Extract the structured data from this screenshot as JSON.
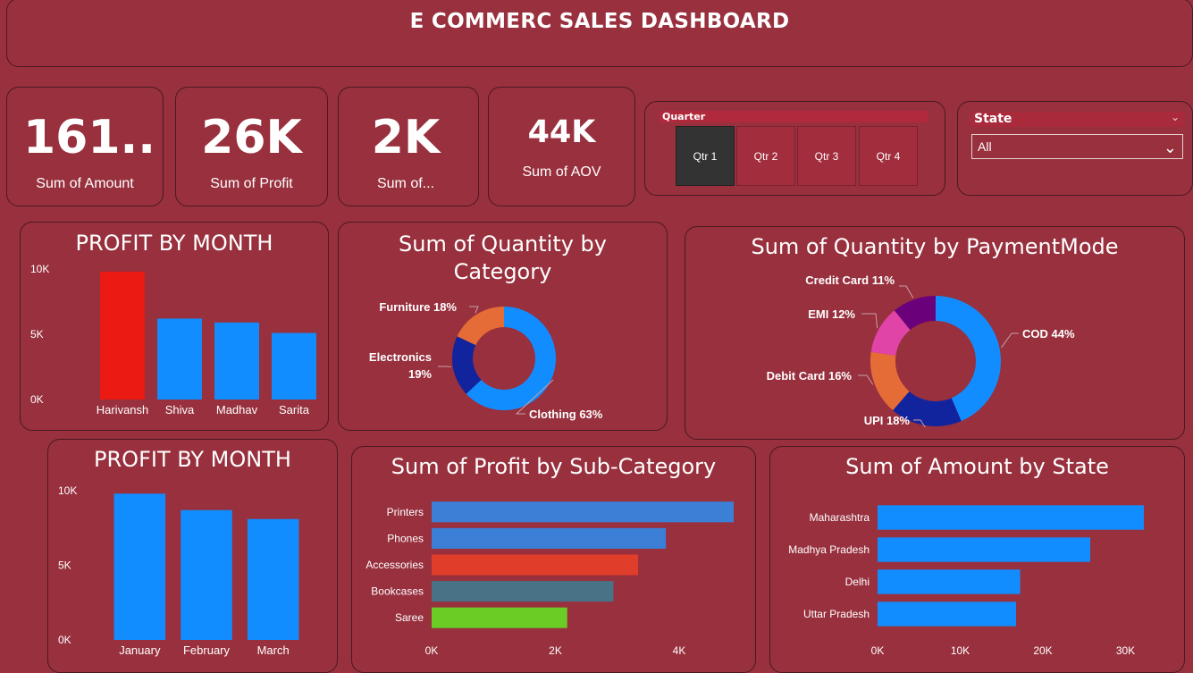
{
  "header": {
    "title": "E COMMERC SALES DASHBOARD"
  },
  "kpis": [
    {
      "value": "161..",
      "label": "Sum of Amount"
    },
    {
      "value": "26K",
      "label": "Sum of Profit"
    },
    {
      "value": "2K",
      "label": "Sum of..."
    },
    {
      "value": "44K",
      "label": "Sum of AOV"
    }
  ],
  "quarter_slicer": {
    "title": "Quarter",
    "options": [
      "Qtr 1",
      "Qtr 2",
      "Qtr 3",
      "Qtr 4"
    ],
    "selected": "Qtr 1"
  },
  "state_slicer": {
    "title": "State",
    "value": "All"
  },
  "colors": {
    "background": "#98303e",
    "blue": "#118dff",
    "red": "#eb1a12",
    "navy": "#12239e",
    "orange": "#e66c37",
    "magenta": "#e044a7",
    "purple": "#6b007b",
    "bar_blue": "#3b7fd6",
    "bar_orange_red": "#e03d2a",
    "bar_slate": "#4a7286",
    "bar_green": "#6acc24"
  },
  "chart_data": [
    {
      "id": "profit_by_person",
      "type": "bar",
      "title": "PROFIT BY MONTH",
      "categories": [
        "Harivansh",
        "Shiva",
        "Madhav",
        "Sarita"
      ],
      "values": [
        9800,
        6200,
        5900,
        5100
      ],
      "bar_colors": [
        "#eb1a12",
        "#118dff",
        "#118dff",
        "#118dff"
      ],
      "yticks": [
        "0K",
        "5K",
        "10K"
      ],
      "ylim": [
        0,
        10000
      ]
    },
    {
      "id": "quantity_by_category",
      "type": "pie",
      "title": "Sum of Quantity by Category",
      "slices": [
        {
          "label": "Clothing",
          "pct": "63%",
          "value": 63,
          "color": "#118dff"
        },
        {
          "label": "Electronics",
          "pct": "19%",
          "value": 19,
          "color": "#12239e"
        },
        {
          "label": "Furniture",
          "pct": "18%",
          "value": 18,
          "color": "#e66c37"
        }
      ]
    },
    {
      "id": "quantity_by_paymentmode",
      "type": "pie",
      "title": "Sum of Quantity by PaymentMode",
      "slices": [
        {
          "label": "COD",
          "pct": "44%",
          "value": 44,
          "color": "#118dff"
        },
        {
          "label": "UPI",
          "pct": "18%",
          "value": 18,
          "color": "#12239e"
        },
        {
          "label": "Debit Card",
          "pct": "16%",
          "value": 16,
          "color": "#e66c37"
        },
        {
          "label": "EMI",
          "pct": "12%",
          "value": 12,
          "color": "#e044a7"
        },
        {
          "label": "Credit Card",
          "pct": "11%",
          "value": 11,
          "color": "#6b007b"
        }
      ]
    },
    {
      "id": "profit_by_month",
      "type": "bar",
      "title": "PROFIT BY MONTH",
      "categories": [
        "January",
        "February",
        "March"
      ],
      "values": [
        9800,
        8700,
        8100
      ],
      "bar_colors": [
        "#118dff",
        "#118dff",
        "#118dff"
      ],
      "yticks": [
        "0K",
        "5K",
        "10K"
      ],
      "ylim": [
        0,
        10000
      ]
    },
    {
      "id": "profit_by_subcategory",
      "type": "bar",
      "orientation": "horizontal",
      "title": "Sum of Profit by Sub-Category",
      "categories": [
        "Printers",
        "Phones",
        "Accessories",
        "Bookcases",
        "Saree"
      ],
      "values": [
        4900,
        3800,
        3350,
        2950,
        2200
      ],
      "bar_colors": [
        "#3b7fd6",
        "#3b7fd6",
        "#e03d2a",
        "#4a7286",
        "#6acc24"
      ],
      "xticks": [
        "0K",
        "2K",
        "4K"
      ],
      "xlim": [
        0,
        4900
      ]
    },
    {
      "id": "amount_by_state",
      "type": "bar",
      "orientation": "horizontal",
      "title": "Sum of Amount by State",
      "categories": [
        "Maharashtra",
        "Madhya Pradesh",
        "Delhi",
        "Uttar Pradesh"
      ],
      "values": [
        32300,
        25800,
        17300,
        16800
      ],
      "bar_colors": [
        "#118dff",
        "#118dff",
        "#118dff",
        "#118dff"
      ],
      "xticks": [
        "0K",
        "10K",
        "20K",
        "30K"
      ],
      "xlim": [
        0,
        32300
      ]
    }
  ]
}
